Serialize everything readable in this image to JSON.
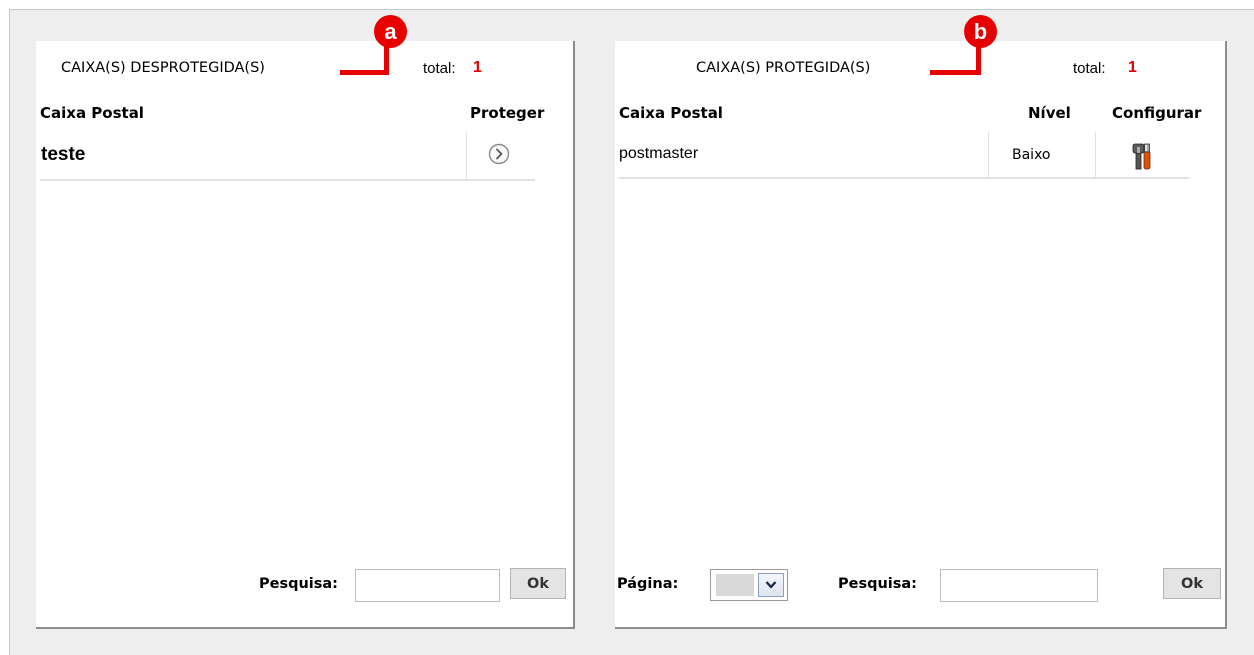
{
  "left_panel": {
    "title": "CAIXA(S) DESPROTEGIDA(S)",
    "total_label": "total:",
    "total_value": "1",
    "columns": [
      "Caixa Postal",
      "Proteger"
    ],
    "rows": [
      {
        "mailbox": "teste",
        "action_icon": "chevron-right-circle-icon"
      }
    ],
    "search_label": "Pesquisa:",
    "search_value": "",
    "ok_label": "Ok"
  },
  "right_panel": {
    "title": "CAIXA(S) PROTEGIDA(S)",
    "total_label": "total:",
    "total_value": "1",
    "columns": [
      "Caixa Postal",
      "Nível",
      "Configurar"
    ],
    "rows": [
      {
        "mailbox": "postmaster",
        "level": "Baixo",
        "action_icon": "tools-icon"
      }
    ],
    "page_label": "Página:",
    "page_value": "",
    "search_label": "Pesquisa:",
    "search_value": "",
    "ok_label": "Ok"
  },
  "callouts": {
    "a": "a",
    "b": "b"
  },
  "colors": {
    "accent_red": "#e60000",
    "total_red": "#e00000",
    "background": "#eeeeee"
  }
}
